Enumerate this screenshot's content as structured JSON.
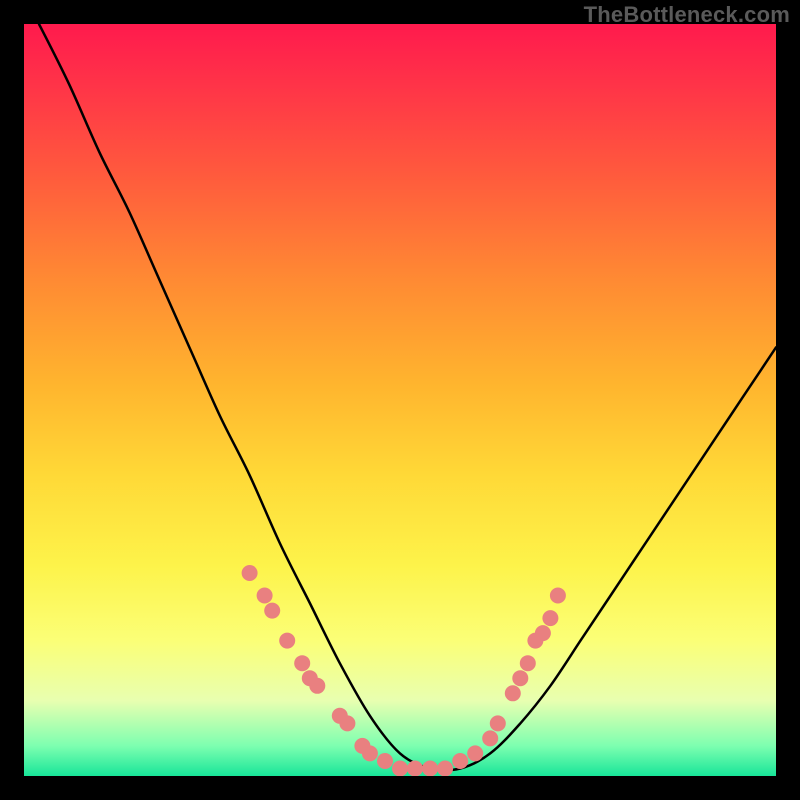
{
  "watermark": {
    "text": "TheBottleneck.com"
  },
  "chart_data": {
    "type": "line",
    "title": "",
    "xlabel": "",
    "ylabel": "",
    "xlim": [
      0,
      100
    ],
    "ylim": [
      0,
      100
    ],
    "grid": false,
    "legend": false,
    "series": [
      {
        "name": "bottleneck-curve",
        "x": [
          2,
          6,
          10,
          14,
          18,
          22,
          26,
          30,
          34,
          38,
          42,
          46,
          50,
          54,
          58,
          62,
          66,
          70,
          74,
          78,
          82,
          86,
          90,
          94,
          98,
          100
        ],
        "y": [
          100,
          92,
          83,
          75,
          66,
          57,
          48,
          40,
          31,
          23,
          15,
          8,
          3,
          1,
          1,
          3,
          7,
          12,
          18,
          24,
          30,
          36,
          42,
          48,
          54,
          57
        ]
      }
    ],
    "markers": {
      "name": "highlighted-points",
      "color": "#e98080",
      "points": [
        {
          "x": 30,
          "y": 27
        },
        {
          "x": 32,
          "y": 24
        },
        {
          "x": 33,
          "y": 22
        },
        {
          "x": 35,
          "y": 18
        },
        {
          "x": 37,
          "y": 15
        },
        {
          "x": 38,
          "y": 13
        },
        {
          "x": 39,
          "y": 12
        },
        {
          "x": 42,
          "y": 8
        },
        {
          "x": 43,
          "y": 7
        },
        {
          "x": 45,
          "y": 4
        },
        {
          "x": 46,
          "y": 3
        },
        {
          "x": 48,
          "y": 2
        },
        {
          "x": 50,
          "y": 1
        },
        {
          "x": 52,
          "y": 1
        },
        {
          "x": 54,
          "y": 1
        },
        {
          "x": 56,
          "y": 1
        },
        {
          "x": 58,
          "y": 2
        },
        {
          "x": 60,
          "y": 3
        },
        {
          "x": 62,
          "y": 5
        },
        {
          "x": 63,
          "y": 7
        },
        {
          "x": 65,
          "y": 11
        },
        {
          "x": 66,
          "y": 13
        },
        {
          "x": 67,
          "y": 15
        },
        {
          "x": 68,
          "y": 18
        },
        {
          "x": 69,
          "y": 19
        },
        {
          "x": 70,
          "y": 21
        },
        {
          "x": 71,
          "y": 24
        }
      ]
    }
  }
}
